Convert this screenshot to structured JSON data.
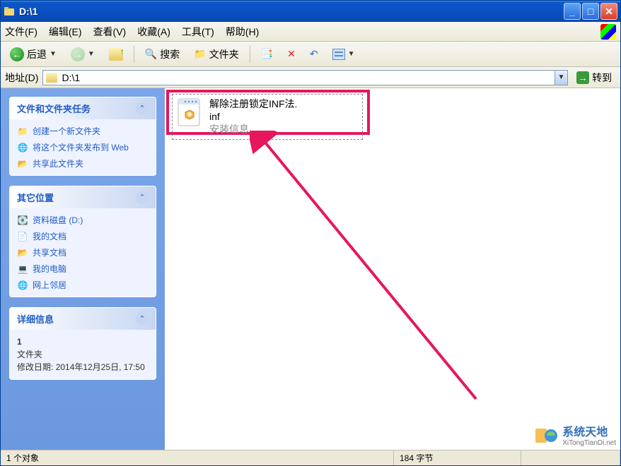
{
  "titlebar": {
    "title": "D:\\1"
  },
  "menubar": {
    "file": "文件(F)",
    "edit": "编辑(E)",
    "view": "查看(V)",
    "favorites": "收藏(A)",
    "tools": "工具(T)",
    "help": "帮助(H)"
  },
  "toolbar": {
    "back": "后退",
    "search": "搜索",
    "folders": "文件夹"
  },
  "addressbar": {
    "label": "地址(D)",
    "path": "D:\\1",
    "go": "转到"
  },
  "sidebar": {
    "tasks": {
      "title": "文件和文件夹任务",
      "items": [
        {
          "icon": "📁",
          "label": "创建一个新文件夹"
        },
        {
          "icon": "🌐",
          "label": "将这个文件夹发布到 Web"
        },
        {
          "icon": "📂",
          "label": "共享此文件夹"
        }
      ]
    },
    "places": {
      "title": "其它位置",
      "items": [
        {
          "icon": "💽",
          "label": "资料磁盘 (D:)"
        },
        {
          "icon": "📄",
          "label": "我的文档"
        },
        {
          "icon": "📂",
          "label": "共享文档"
        },
        {
          "icon": "💻",
          "label": "我的电脑"
        },
        {
          "icon": "🌐",
          "label": "网上邻居"
        }
      ]
    },
    "details": {
      "title": "详细信息",
      "name": "1",
      "type": "文件夹",
      "modified_label": "修改日期:",
      "modified": "2014年12月25日, 17:50"
    }
  },
  "main": {
    "file": {
      "name_line1": "解除注册锁定INF法.",
      "name_line2": "inf",
      "type": "安装信息"
    }
  },
  "statusbar": {
    "objects": "1 个对象",
    "size": "184 字节"
  },
  "watermark": {
    "brand": "系统天地",
    "url": "XiTongTianDi.net"
  }
}
